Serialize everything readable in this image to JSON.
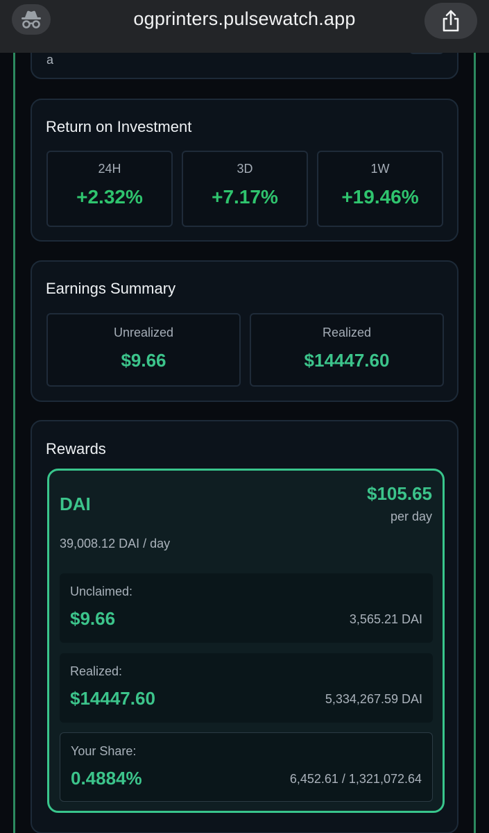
{
  "browser": {
    "url": "ogprinters.pulsewatch.app"
  },
  "prev_card": {
    "partial_text": "a"
  },
  "roi": {
    "title": "Return on Investment",
    "items": [
      {
        "label": "24H",
        "value": "+2.32%"
      },
      {
        "label": "3D",
        "value": "+7.17%"
      },
      {
        "label": "1W",
        "value": "+19.46%"
      }
    ]
  },
  "earnings": {
    "title": "Earnings Summary",
    "unrealized_label": "Unrealized",
    "unrealized_value": "$9.66",
    "realized_label": "Realized",
    "realized_value": "$14447.60"
  },
  "rewards": {
    "title": "Rewards",
    "token": "DAI",
    "per_day_value": "$105.65",
    "per_day_label": "per day",
    "rate": "39,008.12 DAI / day",
    "unclaimed_label": "Unclaimed:",
    "unclaimed_value": "$9.66",
    "unclaimed_amount": "3,565.21 DAI",
    "realized_label": "Realized:",
    "realized_value": "$14447.60",
    "realized_amount": "5,334,267.59 DAI",
    "share_label": "Your Share:",
    "share_value": "0.4884%",
    "share_detail": "6,452.61 / 1,321,072.64"
  },
  "colors": {
    "accent_green": "#2fc46e",
    "teal_green": "#3cc48b",
    "border_green": "#39c58c",
    "card_bg": "#0c131b",
    "page_bg": "#080b10"
  }
}
